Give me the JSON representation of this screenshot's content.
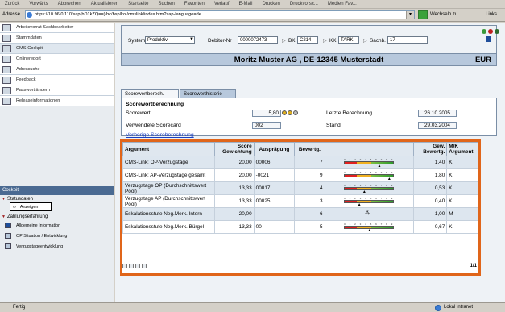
{
  "browser": {
    "menu": [
      "Zurück",
      "Vorwärts",
      "Abbrechen",
      "Aktualisieren",
      "Startseite",
      "Suchen",
      "Favoriten",
      "Verlauf",
      "E-Mail",
      "Drucken",
      "Druckvorsc...",
      "Medien Fav..."
    ],
    "address_label": "Adresse",
    "url": "https://10.96.0.110/sap(bD1kZQ==)/bc/bsp/koi/cmslink/index.htm?sap-language=de",
    "go_label": "Wechseln zu",
    "links_label": "Links",
    "status_left": "Fertig",
    "status_zone": "Lokal intranet"
  },
  "sidebar": {
    "items": [
      {
        "label": "Arbeitsvorrat Sachbearbeiter",
        "icon": "worklist-icon"
      },
      {
        "label": "Stammdaten",
        "icon": "master-data-icon"
      },
      {
        "label": "CMS-Cockpit",
        "icon": "cockpit-icon"
      },
      {
        "label": "Onlinereport",
        "icon": "report-icon"
      },
      {
        "label": "Adressuche",
        "icon": "address-search-icon"
      },
      {
        "label": "Feedback",
        "icon": "feedback-icon"
      },
      {
        "label": "Passwort ändern",
        "icon": "pencil-icon"
      },
      {
        "label": "Releaseinformationen",
        "icon": "info-icon"
      }
    ],
    "cockpit_title": "Cockpit",
    "statusdaten": "Statusdaten",
    "anzeigen_btn": "Anzeigen",
    "zahlungserfahrung": "Zahlungserfahrung",
    "sub_items": [
      {
        "label": "Allgemeine Information",
        "icon": "info-icon"
      },
      {
        "label": "OP Situation / Entwicklung",
        "icon": "people-icon"
      },
      {
        "label": "Verzugstageentwicklung",
        "icon": "people-icon"
      }
    ]
  },
  "header": {
    "system_label": "System",
    "system_value": "Produktiv",
    "debitor_label": "Debitor-Nr",
    "debitor_value": "0000072473",
    "bk_label": "BK",
    "bk_value": "C214",
    "kk_label": "KK",
    "kk_value": "TARK",
    "sachb_label": "Sachb.",
    "sachb_value": "17",
    "company": "Moritz Muster AG , DE-12345 Musterstadt",
    "currency": "EUR"
  },
  "tabs": [
    "Scorewertberech.",
    "Scorewerthistorie"
  ],
  "score": {
    "title": "Scorewortberechnung",
    "scorewert_label": "Scorewert",
    "scorewert_value": "5,80",
    "scorecard_label": "Verwendete Scorecard",
    "scorecard_value": "002",
    "letzte_label": "Letzte Berechnung",
    "letzte_value": "26.10.2005",
    "stand_label": "Stand",
    "stand_value": "29.03.2004",
    "link": "Vorherige Scoreberechnung"
  },
  "table": {
    "headers": [
      "Argument",
      "Score Gewichtung",
      "Ausprägung",
      "Bewertg.",
      "",
      "Gew. Bewertg.",
      "M/K Argument"
    ],
    "rows": [
      {
        "argument": "CMS-Link: OP-Verzugstage",
        "gewichtung": "20,00",
        "auspraegung": "00006",
        "bewertung": "7",
        "pointer": 0.7,
        "gew": "1,40",
        "mk": "K"
      },
      {
        "argument": "CMS-Link: AP-Verzugstage gesamt",
        "gewichtung": "20,00",
        "auspraegung": "-0021",
        "bewertung": "9",
        "pointer": 0.9,
        "gew": "1,80",
        "mk": "K"
      },
      {
        "argument": "Verzugstage OP (Durchschnittswert Pool)",
        "gewichtung": "13,33",
        "auspraegung": "00017",
        "bewertung": "4",
        "pointer": 0.4,
        "gew": "0,53",
        "mk": "K"
      },
      {
        "argument": "Verzugstage AP (Durchschnittswert Pool)",
        "gewichtung": "13,33",
        "auspraegung": "00025",
        "bewertung": "3",
        "pointer": 0.3,
        "gew": "0,40",
        "mk": "K"
      },
      {
        "argument": "Eskalationsstufe Neg.Merk. Intern",
        "gewichtung": "20,00",
        "auspraegung": "",
        "bewertung": "6",
        "pointer": null,
        "gew": "1,00",
        "mk": "M"
      },
      {
        "argument": "Eskalationsstufe Neg.Merk. Bürgel",
        "gewichtung": "13,33",
        "auspraegung": "00",
        "bewertung": "5",
        "pointer": 0.5,
        "gew": "0,67",
        "mk": "K"
      }
    ],
    "gauge_scale": "0 1 2 3 4 5 6 7 8 9",
    "page": "1/1"
  }
}
